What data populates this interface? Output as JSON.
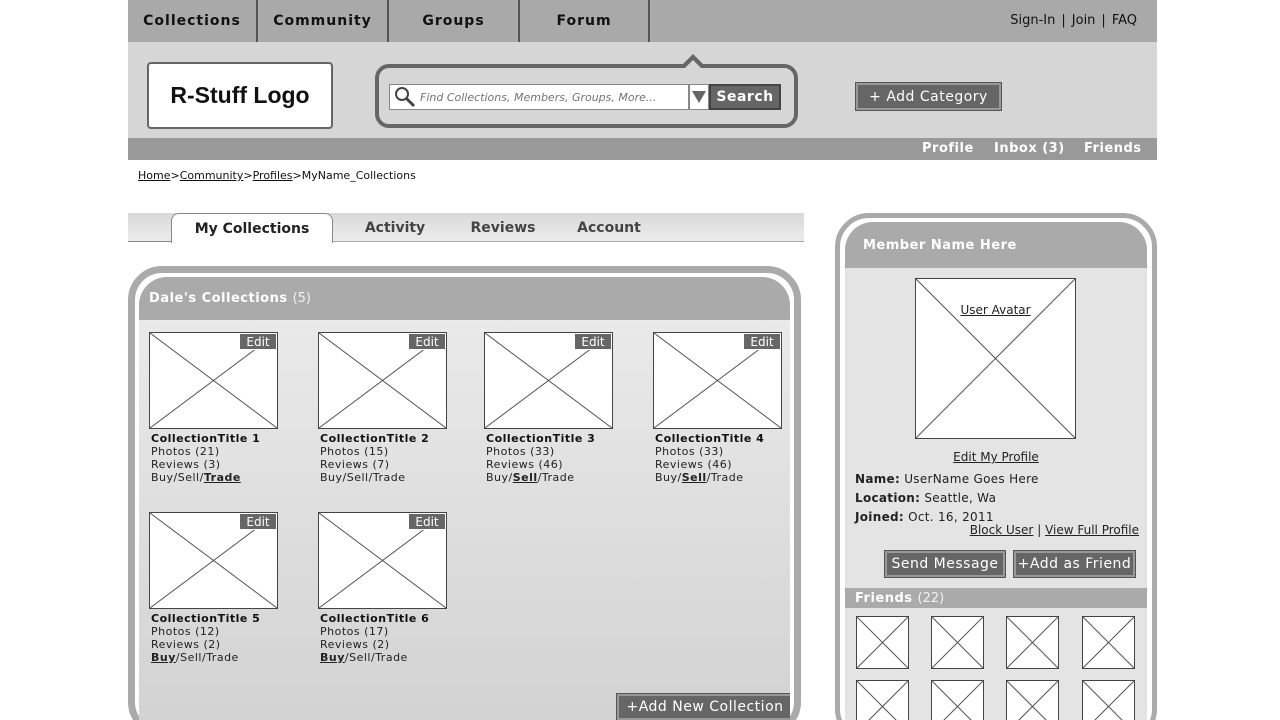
{
  "topnav": {
    "tabs": [
      "Collections",
      "Community",
      "Groups",
      "Forum"
    ],
    "auth": {
      "signin": "Sign-In",
      "join": "Join",
      "faq": "FAQ",
      "sep": "|"
    }
  },
  "header": {
    "logo": "R-Stuff Logo",
    "search": {
      "placeholder": "Find Collections, Members, Groups, More...",
      "button": "Search"
    },
    "add_category": "+ Add Category"
  },
  "subnav": {
    "profile": "Profile",
    "inbox": "Inbox (3)",
    "friends": "Friends"
  },
  "breadcrumb": {
    "items": [
      "Home",
      "Community",
      "Profiles"
    ],
    "current": "MyName_Collections",
    "sep": ">"
  },
  "tabs": [
    "My Collections",
    "Activity",
    "Reviews",
    "Account"
  ],
  "collections": {
    "title": "Dale's Collections",
    "count": "(5)",
    "edit_label": "Edit",
    "buy": "Buy",
    "sell": "Sell",
    "trade": "Trade",
    "slash": "/",
    "items": [
      {
        "title": "CollectionTitle 1",
        "photos": "Photos (21)",
        "reviews": "Reviews (3)",
        "highlight": "trade"
      },
      {
        "title": "CollectionTitle 2",
        "photos": "Photos (15)",
        "reviews": "Reviews (7)",
        "highlight": ""
      },
      {
        "title": "CollectionTitle 3",
        "photos": "Photos (33)",
        "reviews": "Reviews (46)",
        "highlight": "sell"
      },
      {
        "title": "CollectionTitle 4",
        "photos": "Photos (33)",
        "reviews": "Reviews (46)",
        "highlight": "sell"
      },
      {
        "title": "CollectionTitle 5",
        "photos": "Photos (12)",
        "reviews": "Reviews (2)",
        "highlight": "buy"
      },
      {
        "title": "CollectionTitle 6",
        "photos": "Photos (17)",
        "reviews": "Reviews (2)",
        "highlight": "buy"
      }
    ],
    "add_button": "+Add New Collection"
  },
  "member": {
    "title": "Member Name Here",
    "avatar_label": "User Avatar",
    "edit_profile": "Edit My Profile",
    "name_label": "Name:",
    "name": "UserName Goes Here",
    "location_label": "Location:",
    "location": "Seattle, Wa",
    "joined_label": "Joined:",
    "joined": "Oct. 16, 2011",
    "block_user": "Block User",
    "link_sep": "|",
    "view_full": "View Full Profile",
    "send_message": "Send Message",
    "add_friend": "+Add as Friend",
    "friends_title": "Friends",
    "friends_count": "(22)"
  }
}
